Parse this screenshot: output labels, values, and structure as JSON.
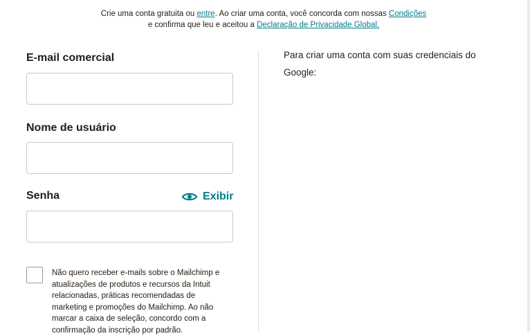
{
  "intro": {
    "text1": "Crie uma conta gratuita ou ",
    "login_link": "entre",
    "text2": ". Ao criar uma conta, você concorda com nossas ",
    "terms_link": "Condições",
    "text3": "e confirma que leu e aceitou a ",
    "privacy_link": "Declaração de Privacidade Global."
  },
  "form": {
    "email_label": "E-mail comercial",
    "email_value": "",
    "username_label": "Nome de usuário",
    "username_value": "",
    "password_label": "Senha",
    "password_value": "",
    "show_password_label": "Exibir",
    "show_password_icon": "eye-icon",
    "optout_checked": false,
    "optout_text": "Não quero receber e-mails sobre o Mailchimp e atualizações de produtos e recursos da Intuit relacionadas, práticas recomendadas de marketing e promoções do Mailchimp. Ao não marcar a caixa de seleção, concordo com a confirmação da inscrição por padrão."
  },
  "google": {
    "text": "Para criar uma conta com suas credenciais do Google:"
  },
  "colors": {
    "accent": "#007c89",
    "text": "#241c15",
    "border": "#c9c9c9"
  }
}
